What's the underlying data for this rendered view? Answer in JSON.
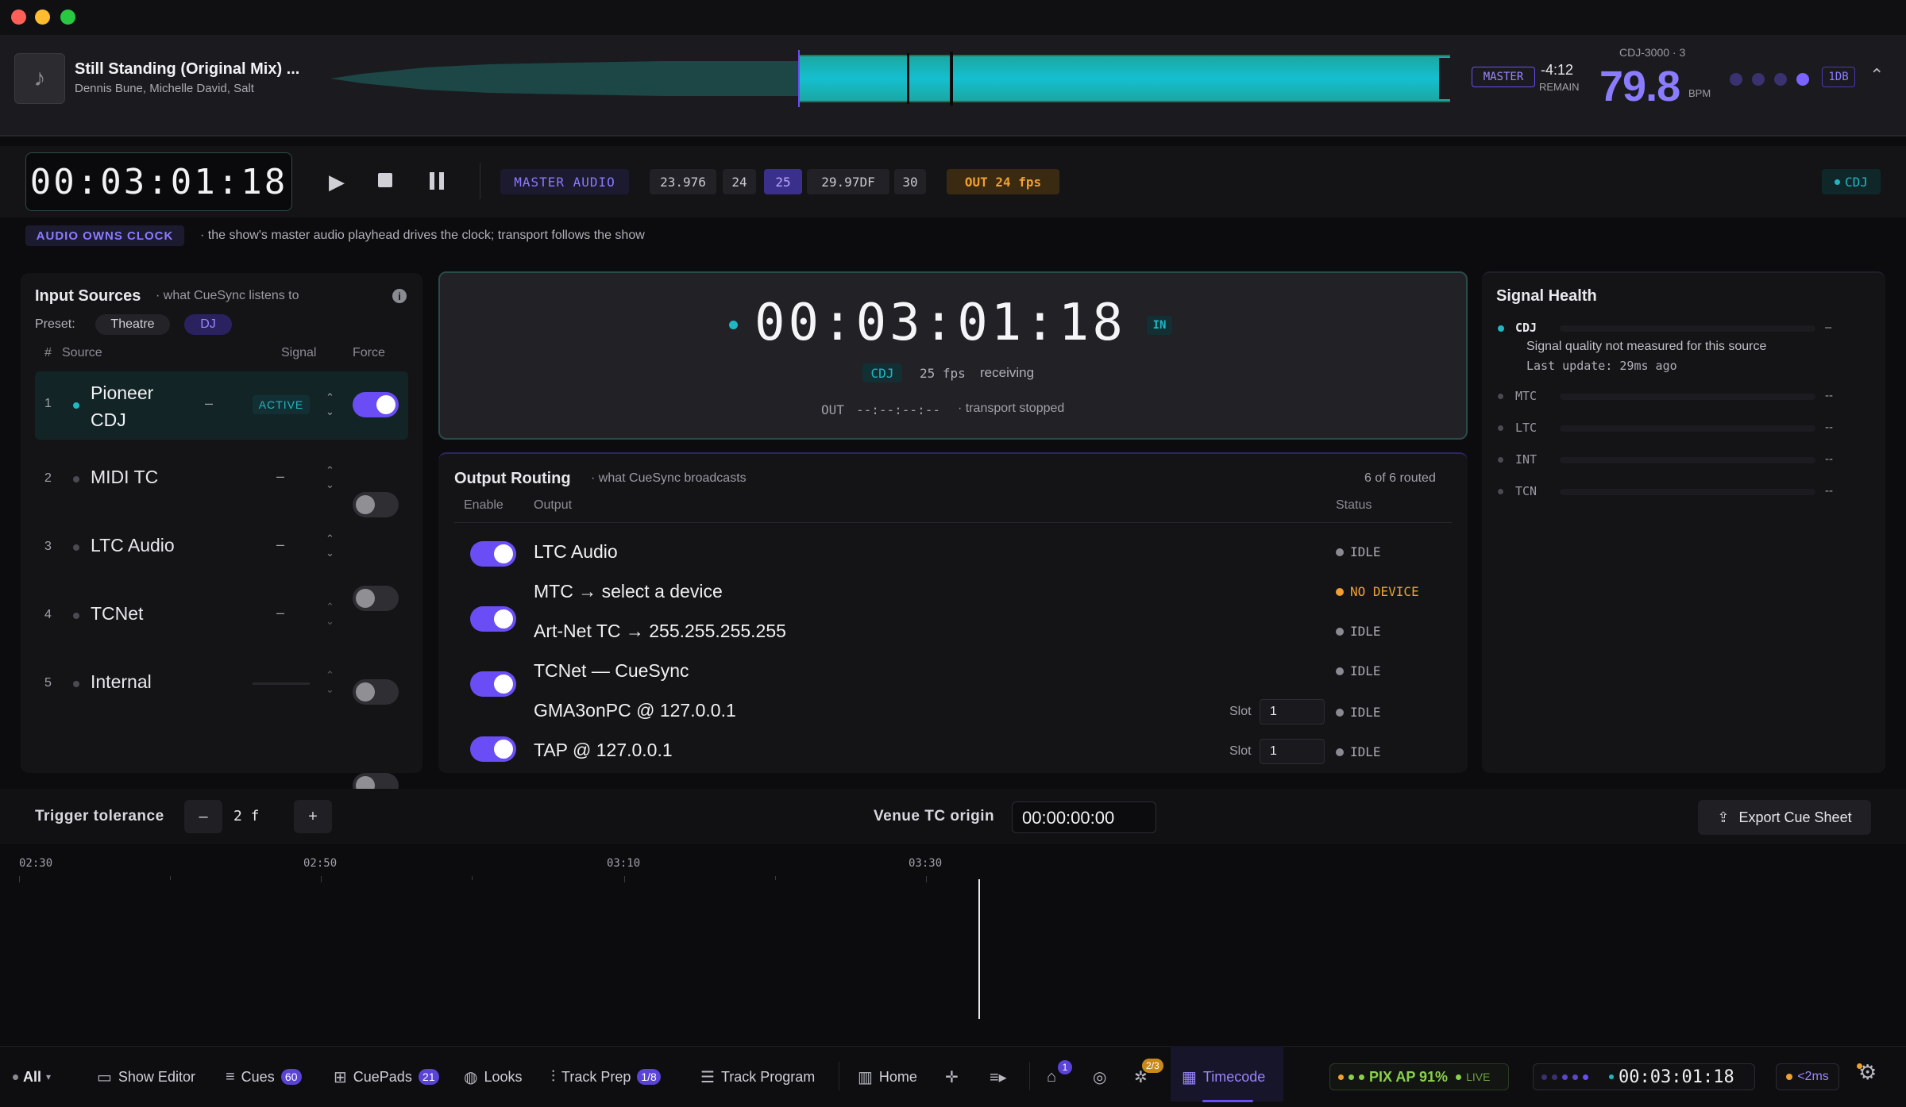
{
  "deck": {
    "track_title": "Still Standing (Original Mix) ...",
    "track_artists": "Dennis Bune, Michelle David, Salt",
    "master_badge": "MASTER",
    "remain_time": "-4:12",
    "remain_label": "REMAIN",
    "device": "CDJ-3000 · 3",
    "bpm": "79.8",
    "bpm_label": "BPM",
    "beat_badge": "1DB",
    "collapse_icon": "chevron-up-icon"
  },
  "transport": {
    "timecode": "00:03:01:18",
    "clock_source": "MASTER AUDIO",
    "fps_options": [
      "23.976",
      "24",
      "25",
      "29.97DF",
      "30"
    ],
    "fps_selected": "25",
    "out_fps": "OUT 24 fps",
    "source_tag": "CDJ",
    "clock_badge": "AUDIO OWNS CLOCK",
    "clock_note": "· the show's master audio playhead drives the clock; transport follows the show"
  },
  "input_sources": {
    "title": "Input Sources",
    "subtitle": "· what CueSync listens to",
    "preset_label": "Preset:",
    "presets": [
      "Theatre",
      "DJ"
    ],
    "columns": [
      "#",
      "Source",
      "Signal",
      "Force"
    ],
    "rows": [
      {
        "num": "1",
        "name": "Pioneer CDJ",
        "signal": "–",
        "status": "ACTIVE",
        "forced": true
      },
      {
        "num": "2",
        "name": "MIDI TC",
        "signal": "–",
        "forced": false
      },
      {
        "num": "3",
        "name": "LTC Audio",
        "signal": "–",
        "forced": false
      },
      {
        "num": "4",
        "name": "TCNet",
        "signal": "–",
        "forced": false
      },
      {
        "num": "5",
        "name": "Internal",
        "signal": "",
        "forced": false
      }
    ]
  },
  "center_clock": {
    "timecode": "00:03:01:18",
    "in_badge": "IN",
    "source": "CDJ",
    "fps": "25 fps",
    "state": "receiving",
    "out_label": "OUT",
    "out_timecode": "--:--:--:--",
    "out_state": "· transport stopped"
  },
  "output_routing": {
    "title": "Output Routing",
    "subtitle": "· what CueSync broadcasts",
    "count": "6 of 6 routed",
    "columns": [
      "Enable",
      "Output",
      "Status"
    ],
    "slot_label": "Slot",
    "rows": [
      {
        "name": "LTC Audio",
        "status": "IDLE",
        "slot": ""
      },
      {
        "name": "MTC → select a device",
        "status": "NO DEVICE",
        "slot": ""
      },
      {
        "name": "Art-Net TC → 255.255.255.255",
        "status": "IDLE",
        "slot": ""
      },
      {
        "name": "TCNet — CueSync",
        "status": "IDLE",
        "slot": ""
      },
      {
        "name": "GMA3onPC @ 127.0.0.1",
        "status": "IDLE",
        "slot": "1"
      },
      {
        "name": "TAP @ 127.0.0.1",
        "status": "IDLE",
        "slot": "1"
      }
    ]
  },
  "signal_health": {
    "title": "Signal Health",
    "primary": {
      "name": "CDJ",
      "value": "–",
      "note": "Signal quality not measured for this source",
      "last_update": "Last update: 29ms ago"
    },
    "others": [
      {
        "name": "MTC",
        "value": "--"
      },
      {
        "name": "LTC",
        "value": "--"
      },
      {
        "name": "INT",
        "value": "--"
      },
      {
        "name": "TCN",
        "value": "--"
      }
    ]
  },
  "controls": {
    "trigger_label": "Trigger tolerance",
    "minus": "–",
    "tolerance": "2 f",
    "plus": "+",
    "venue_label": "Venue TC origin",
    "venue_value": "00:00:00:00",
    "export_label": "Export Cue Sheet"
  },
  "timeline": {
    "ticks": [
      "02:30",
      "02:50",
      "03:10",
      "03:30"
    ]
  },
  "taskbar": {
    "filter": "All",
    "items": [
      {
        "label": "Show Editor"
      },
      {
        "label": "Cues",
        "badge": "60"
      },
      {
        "label": "CuePads",
        "badge": "21"
      },
      {
        "label": "Looks"
      },
      {
        "label": "Track Prep",
        "badge": "1/8"
      },
      {
        "label": "Track Program"
      },
      {
        "label": "Home"
      },
      {
        "label": "Timecode"
      }
    ],
    "alert_badge": "1",
    "group_badge": "2/3",
    "pix_status": "PIX AP 91%",
    "live_label": "LIVE",
    "timecode": "00:03:01:18",
    "latency": "<2ms"
  },
  "colors": {
    "accent": "#6a4df5",
    "teal": "#1fb7c4",
    "amber": "#f0a030"
  }
}
